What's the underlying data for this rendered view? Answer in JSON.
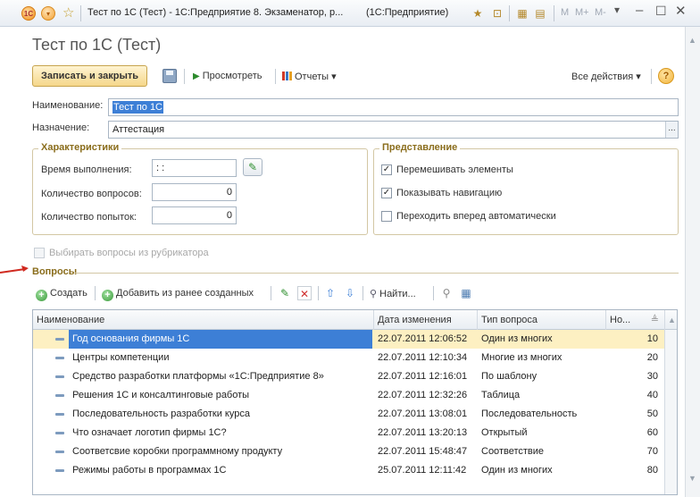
{
  "window": {
    "title": "Тест по 1С (Тест) - 1С:Предприятие 8. Экзаменатор, р...",
    "app": "(1С:Предприятие)",
    "mem_buttons": [
      "M",
      "M+",
      "M-"
    ]
  },
  "form": {
    "title": "Тест по 1С (Тест)"
  },
  "toolbar": {
    "save_close": "Записать и закрыть",
    "preview": "Просмотреть",
    "reports": "Отчеты",
    "all_actions": "Все действия",
    "help": "?"
  },
  "fields": {
    "name_label": "Наименование:",
    "name_value": "Тест по 1С",
    "purpose_label": "Назначение:",
    "purpose_value": "Аттестация"
  },
  "characteristics": {
    "title": "Характеристики",
    "time_label": "Время выполнения:",
    "time_value": ": :",
    "questions_label": "Количество вопросов:",
    "questions_value": "0",
    "attempts_label": "Количество попыток:",
    "attempts_value": "0"
  },
  "presentation": {
    "title": "Представление",
    "shuffle_label": "Перемешивать элементы",
    "shuffle_checked": true,
    "nav_label": "Показывать навигацию",
    "nav_checked": true,
    "auto_label": "Переходить вперед автоматически",
    "auto_checked": false
  },
  "rubricator": {
    "label": "Выбирать вопросы из рубрикатора"
  },
  "questions": {
    "title": "Вопросы",
    "create": "Создать",
    "add_existing": "Добавить из ранее созданных",
    "find": "Найти...",
    "columns": [
      "Наименование",
      "Дата изменения",
      "Тип вопроса",
      "Но..."
    ],
    "rows": [
      {
        "name": "Год основания фирмы 1С",
        "date": "22.07.2011 12:06:52",
        "type": "Один из многих",
        "num": "10"
      },
      {
        "name": "Центры компетенции",
        "date": "22.07.2011 12:10:34",
        "type": "Многие из многих",
        "num": "20"
      },
      {
        "name": "Средство разработки платформы «1С:Предприятие 8»",
        "date": "22.07.2011 12:16:01",
        "type": "По шаблону",
        "num": "30"
      },
      {
        "name": "Решения 1С и консалтинговые работы",
        "date": "22.07.2011 12:32:26",
        "type": "Таблица",
        "num": "40"
      },
      {
        "name": "Последовательность разработки курса",
        "date": "22.07.2011 13:08:01",
        "type": "Последовательность",
        "num": "50"
      },
      {
        "name": "Что означает логотип фирмы 1С?",
        "date": "22.07.2011 13:20:13",
        "type": "Открытый",
        "num": "60"
      },
      {
        "name": "Соответсвие коробки программному продукту",
        "date": "22.07.2011 15:48:47",
        "type": "Соответствие",
        "num": "70"
      },
      {
        "name": "Режимы работы в программах 1С",
        "date": "25.07.2011 12:11:42",
        "type": "Один из многих",
        "num": "80"
      }
    ]
  }
}
